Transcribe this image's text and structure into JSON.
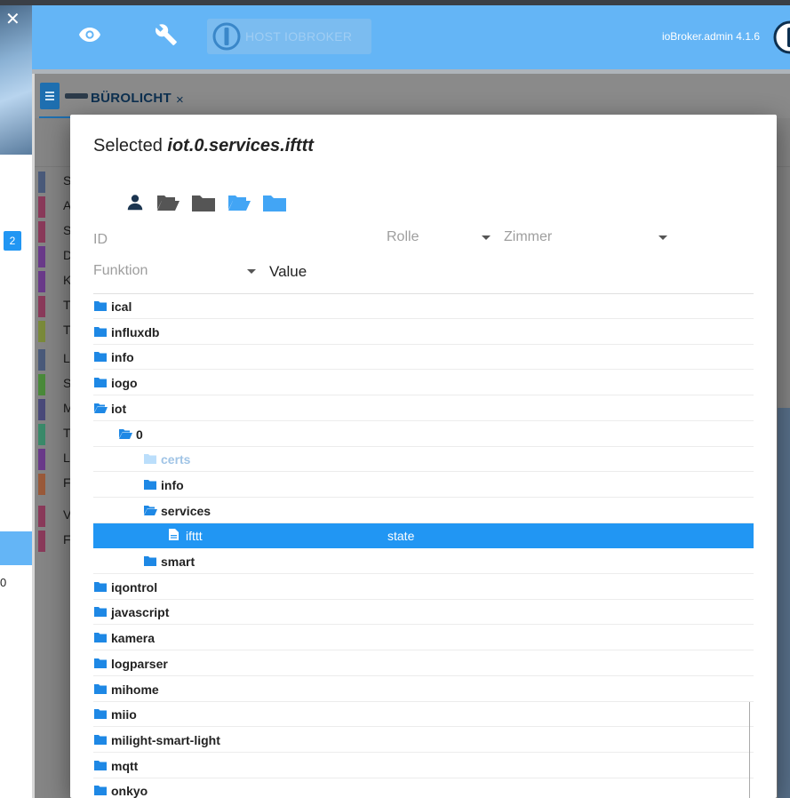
{
  "app": {
    "host_button_label": "HOST IOBROKER",
    "version": "ioBroker.admin 4.1.6"
  },
  "sidebar": {
    "badge_count": "2",
    "bottom_value": "0"
  },
  "background_tab": {
    "label": "BÜROLICHT",
    "close_glyph": "×",
    "row_letters": [
      "S",
      "A",
      "S",
      "D",
      "K",
      "T",
      "T",
      "L",
      "S",
      "M",
      "T",
      "L",
      "F",
      "V",
      "F"
    ]
  },
  "dialog": {
    "title_prefix": "Selected ",
    "selected_id": "iot.0.services.ifttt",
    "toolbar_icons": [
      "user-icon",
      "folder-open-icon",
      "folder-icon",
      "folder-open-blue-icon",
      "folder-blue-icon"
    ],
    "filters": {
      "id_placeholder": "ID",
      "role_label": "Rolle",
      "room_label": "Zimmer",
      "function_label": "Funktion",
      "value_header": "Value"
    },
    "tree": [
      {
        "name": "ical",
        "icon": "folder-icon",
        "level": 0,
        "role": ""
      },
      {
        "name": "influxdb",
        "icon": "folder-icon",
        "level": 0,
        "role": ""
      },
      {
        "name": "info",
        "icon": "folder-icon",
        "level": 0,
        "role": ""
      },
      {
        "name": "iogo",
        "icon": "folder-icon",
        "level": 0,
        "role": ""
      },
      {
        "name": "iot",
        "icon": "folder-open-icon",
        "level": 0,
        "role": ""
      },
      {
        "name": "0",
        "icon": "folder-open-icon",
        "level": 1,
        "role": ""
      },
      {
        "name": "certs",
        "icon": "folder-icon",
        "level": 2,
        "role": "",
        "dim": true
      },
      {
        "name": "info",
        "icon": "folder-icon",
        "level": 2,
        "role": ""
      },
      {
        "name": "services",
        "icon": "folder-open-icon",
        "level": 2,
        "role": ""
      },
      {
        "name": "ifttt",
        "icon": "file-icon",
        "level": 3,
        "role": "state",
        "selected": true
      },
      {
        "name": "smart",
        "icon": "folder-icon",
        "level": 2,
        "role": ""
      },
      {
        "name": "iqontrol",
        "icon": "folder-icon",
        "level": 0,
        "role": ""
      },
      {
        "name": "javascript",
        "icon": "folder-icon",
        "level": 0,
        "role": ""
      },
      {
        "name": "kamera",
        "icon": "folder-icon",
        "level": 0,
        "role": ""
      },
      {
        "name": "logparser",
        "icon": "folder-icon",
        "level": 0,
        "role": ""
      },
      {
        "name": "mihome",
        "icon": "folder-icon",
        "level": 0,
        "role": ""
      },
      {
        "name": "miio",
        "icon": "folder-icon",
        "level": 0,
        "role": ""
      },
      {
        "name": "milight-smart-light",
        "icon": "folder-icon",
        "level": 0,
        "role": ""
      },
      {
        "name": "mqtt",
        "icon": "folder-icon",
        "level": 0,
        "role": ""
      },
      {
        "name": "onkyo",
        "icon": "folder-icon",
        "level": 0,
        "role": ""
      }
    ]
  },
  "colors": {
    "appbar": "#64b5f6",
    "accent": "#2196f3",
    "folder": "#1e88e5",
    "selected_row": "#2196f3"
  }
}
